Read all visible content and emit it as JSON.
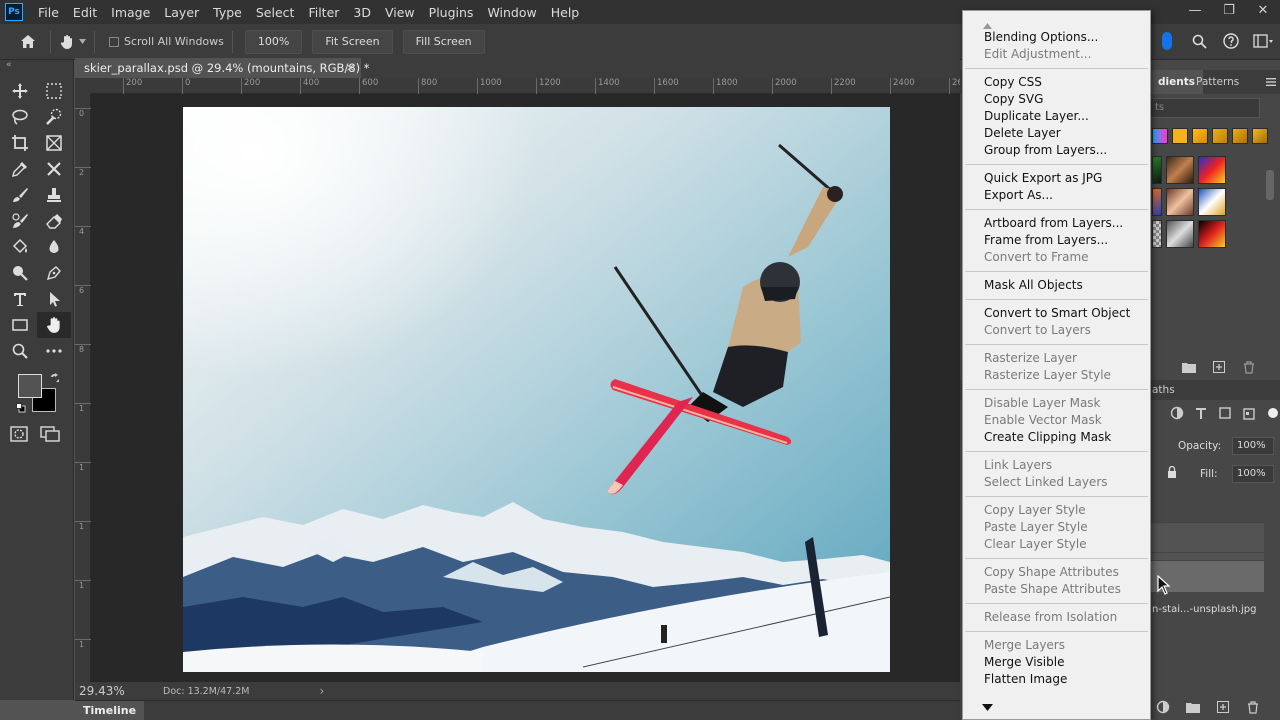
{
  "app": {
    "logo_text": "Ps",
    "menu": [
      "File",
      "Edit",
      "Image",
      "Layer",
      "Type",
      "Select",
      "Filter",
      "3D",
      "View",
      "Plugins",
      "Window",
      "Help"
    ],
    "window_controls": {
      "minimize": "—",
      "restore": "❐",
      "close": "✕"
    }
  },
  "options_bar": {
    "scroll_all_windows_label": "Scroll All Windows",
    "zoom_value": "100%",
    "fit_screen_label": "Fit Screen",
    "fill_screen_label": "Fill Screen"
  },
  "document": {
    "tab_title": "skier_parallax.psd @ 29.4% (mountains, RGB/8) *",
    "close_glyph": "×",
    "ruler_h_labels": [
      "200",
      "0",
      "200",
      "400",
      "600",
      "800",
      "1000",
      "1200",
      "1400",
      "1600",
      "1800",
      "2000",
      "2200",
      "2400",
      "26"
    ],
    "ruler_v_labels": [
      "0",
      "2",
      "4",
      "6",
      "8",
      "1",
      "1",
      "1",
      "1",
      "1"
    ]
  },
  "status": {
    "zoom": "29.43%",
    "doc_size": "Doc: 13.2M/47.2M",
    "arrow": "›"
  },
  "timeline": {
    "label": "Timeline"
  },
  "right_panel": {
    "tab_gradients": "dients",
    "tab_patterns": "Patterns",
    "search_placeholder": "ts",
    "paths_tab": "aths",
    "opacity_label": "Opacity:",
    "opacity_value": "100%",
    "fill_label": "Fill:",
    "fill_value": "100%",
    "layer_name": "n-stai...-unsplash.jpg"
  },
  "context_menu": {
    "groups": [
      [
        {
          "label": "Blending Options...",
          "enabled": true
        },
        {
          "label": "Edit Adjustment...",
          "enabled": false
        }
      ],
      [
        {
          "label": "Copy CSS",
          "enabled": true
        },
        {
          "label": "Copy SVG",
          "enabled": true
        },
        {
          "label": "Duplicate Layer...",
          "enabled": true
        },
        {
          "label": "Delete Layer",
          "enabled": true
        },
        {
          "label": "Group from Layers...",
          "enabled": true
        }
      ],
      [
        {
          "label": "Quick Export as JPG",
          "enabled": true
        },
        {
          "label": "Export As...",
          "enabled": true
        }
      ],
      [
        {
          "label": "Artboard from Layers...",
          "enabled": true
        },
        {
          "label": "Frame from Layers...",
          "enabled": true
        },
        {
          "label": "Convert to Frame",
          "enabled": false
        }
      ],
      [
        {
          "label": "Mask All Objects",
          "enabled": true
        }
      ],
      [
        {
          "label": "Convert to Smart Object",
          "enabled": true
        },
        {
          "label": "Convert to Layers",
          "enabled": false
        }
      ],
      [
        {
          "label": "Rasterize Layer",
          "enabled": false
        },
        {
          "label": "Rasterize Layer Style",
          "enabled": false
        }
      ],
      [
        {
          "label": "Disable Layer Mask",
          "enabled": false
        },
        {
          "label": "Enable Vector Mask",
          "enabled": false
        },
        {
          "label": "Create Clipping Mask",
          "enabled": true
        }
      ],
      [
        {
          "label": "Link Layers",
          "enabled": false
        },
        {
          "label": "Select Linked Layers",
          "enabled": false
        }
      ],
      [
        {
          "label": "Copy Layer Style",
          "enabled": false
        },
        {
          "label": "Paste Layer Style",
          "enabled": false
        },
        {
          "label": "Clear Layer Style",
          "enabled": false
        }
      ],
      [
        {
          "label": "Copy Shape Attributes",
          "enabled": false
        },
        {
          "label": "Paste Shape Attributes",
          "enabled": false
        }
      ],
      [
        {
          "label": "Release from Isolation",
          "enabled": false
        }
      ],
      [
        {
          "label": "Merge Layers",
          "enabled": false
        },
        {
          "label": "Merge Visible",
          "enabled": true
        },
        {
          "label": "Flatten Image",
          "enabled": true
        }
      ]
    ]
  },
  "colors": {
    "accent": "#31a8ff",
    "ui_dark": "#323232",
    "ui_panel": "#3c3c3c",
    "canvas_bg": "#282828",
    "menu_bg": "#f0f0f0"
  }
}
